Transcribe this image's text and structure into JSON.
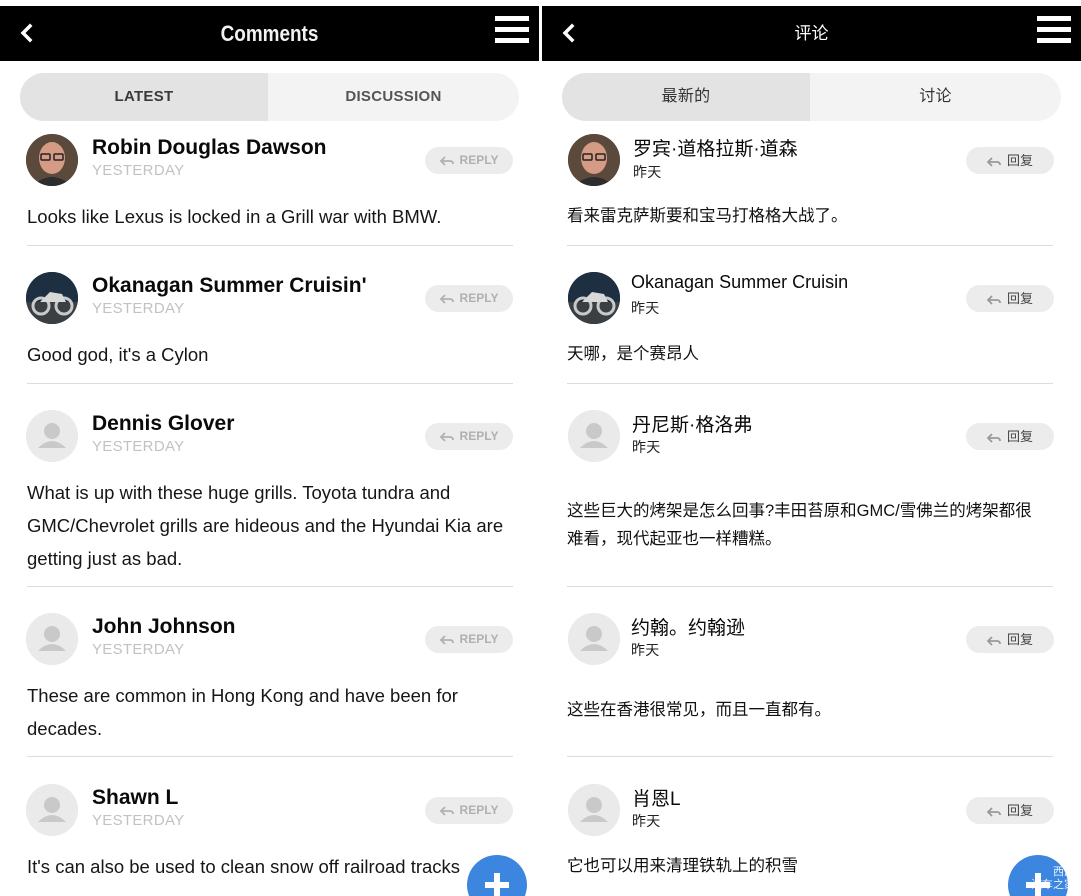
{
  "english": {
    "header": {
      "title": "Comments"
    },
    "tabs": {
      "latest": "LATEST",
      "discussion": "DISCUSSION"
    },
    "reply_label": "REPLY",
    "comments": [
      {
        "author": "Robin Douglas Dawson",
        "time": "YESTERDAY",
        "text": "Looks like Lexus is locked in a Grill war with BMW."
      },
      {
        "author": "Okanagan Summer Cruisin'",
        "time": "YESTERDAY",
        "text": "Good god, it's a Cylon"
      },
      {
        "author": "Dennis Glover",
        "time": "YESTERDAY",
        "text": "What is up with these huge grills. Toyota tundra and GMC/Chevrolet grills are hideous and the Hyundai Kia are getting just as bad."
      },
      {
        "author": "John Johnson",
        "time": "YESTERDAY",
        "text": "These are common in Hong Kong and have been for decades."
      },
      {
        "author": "Shawn L",
        "time": "YESTERDAY",
        "text": "It's can also be used to clean snow off railroad tracks"
      }
    ]
  },
  "chinese": {
    "header": {
      "title": "评论"
    },
    "tabs": {
      "latest": "最新的",
      "discussion": "讨论"
    },
    "reply_label": "回复",
    "comments": [
      {
        "author": "罗宾·道格拉斯·道森",
        "time": "昨天",
        "text": "看来雷克萨斯要和宝马打格格大战了。"
      },
      {
        "author": "Okanagan Summer Cruisin",
        "time": "昨天",
        "text": "天哪，是个赛昂人"
      },
      {
        "author": "丹尼斯·格洛弗",
        "time": "昨天",
        "text": "这些巨大的烤架是怎么回事?丰田苔原和GMC/雪佛兰的烤架都很难看，现代起亚也一样糟糕。"
      },
      {
        "author": "约翰。约翰逊",
        "time": "昨天",
        "text": "这些在香港很常见，而且一直都有。"
      },
      {
        "author": "肖恩L",
        "time": "昨天",
        "text": "它也可以用来清理铁轨上的积雪"
      }
    ]
  },
  "watermark": {
    "line1": "西游",
    "line2": "汽车之家"
  },
  "icons": {
    "back": "chevron-left-icon",
    "menu": "hamburger-menu-icon",
    "reply": "reply-arrow-icon",
    "avatar_default": "default-user-avatar-icon",
    "fab": "plus-icon"
  },
  "colors": {
    "header_bg": "#000000",
    "fab": "#3d86e0",
    "active_tab": "#e3e3e3",
    "timestamp": "#c2c2c2"
  }
}
